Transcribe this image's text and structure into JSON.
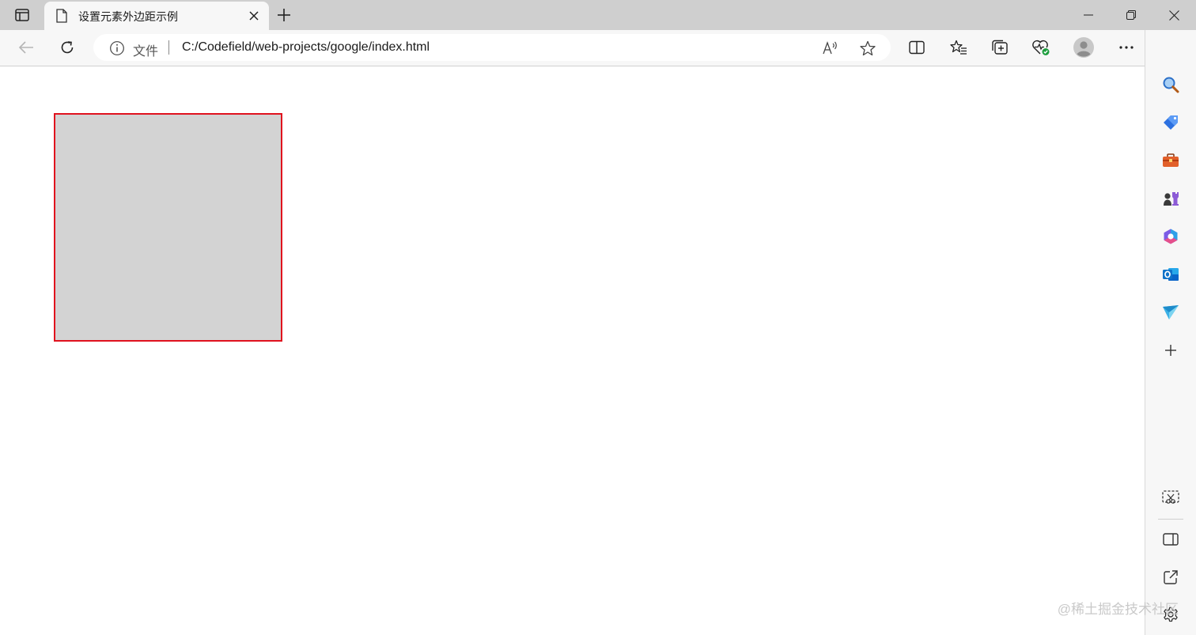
{
  "browser": {
    "tab": {
      "title": "设置元素外边距示例",
      "favicon": "page-icon",
      "close_icon": "close-icon"
    },
    "new_tab_icon": "plus-icon",
    "window_controls": [
      "minimize-icon",
      "restore-icon",
      "close-icon"
    ],
    "address_bar": {
      "info_icon": "info-icon",
      "scheme_label": "文件",
      "url": "C:/Codefield/web-projects/google/index.html",
      "read_aloud_icon": "read-aloud-icon",
      "favorite_icon": "star-icon"
    },
    "toolbar_icons": [
      "split-screen-icon",
      "favorites-icon",
      "collections-icon",
      "browser-essentials-icon",
      "profile-avatar",
      "more-icon",
      "bing-copilot-icon"
    ]
  },
  "page": {
    "box": {
      "fill_color": "#d3d3d3",
      "border_color": "#e0121e"
    }
  },
  "sidebar": {
    "items": [
      "search-icon",
      "shopping-icon",
      "tools-icon",
      "games-icon",
      "office-icon",
      "outlook-icon",
      "drop-icon",
      "add-icon"
    ],
    "bottom_items": [
      "screenshot-icon",
      "sidebar-toggle-icon",
      "open-external-icon",
      "settings-icon"
    ]
  },
  "watermark": "@稀土掘金技术社区"
}
